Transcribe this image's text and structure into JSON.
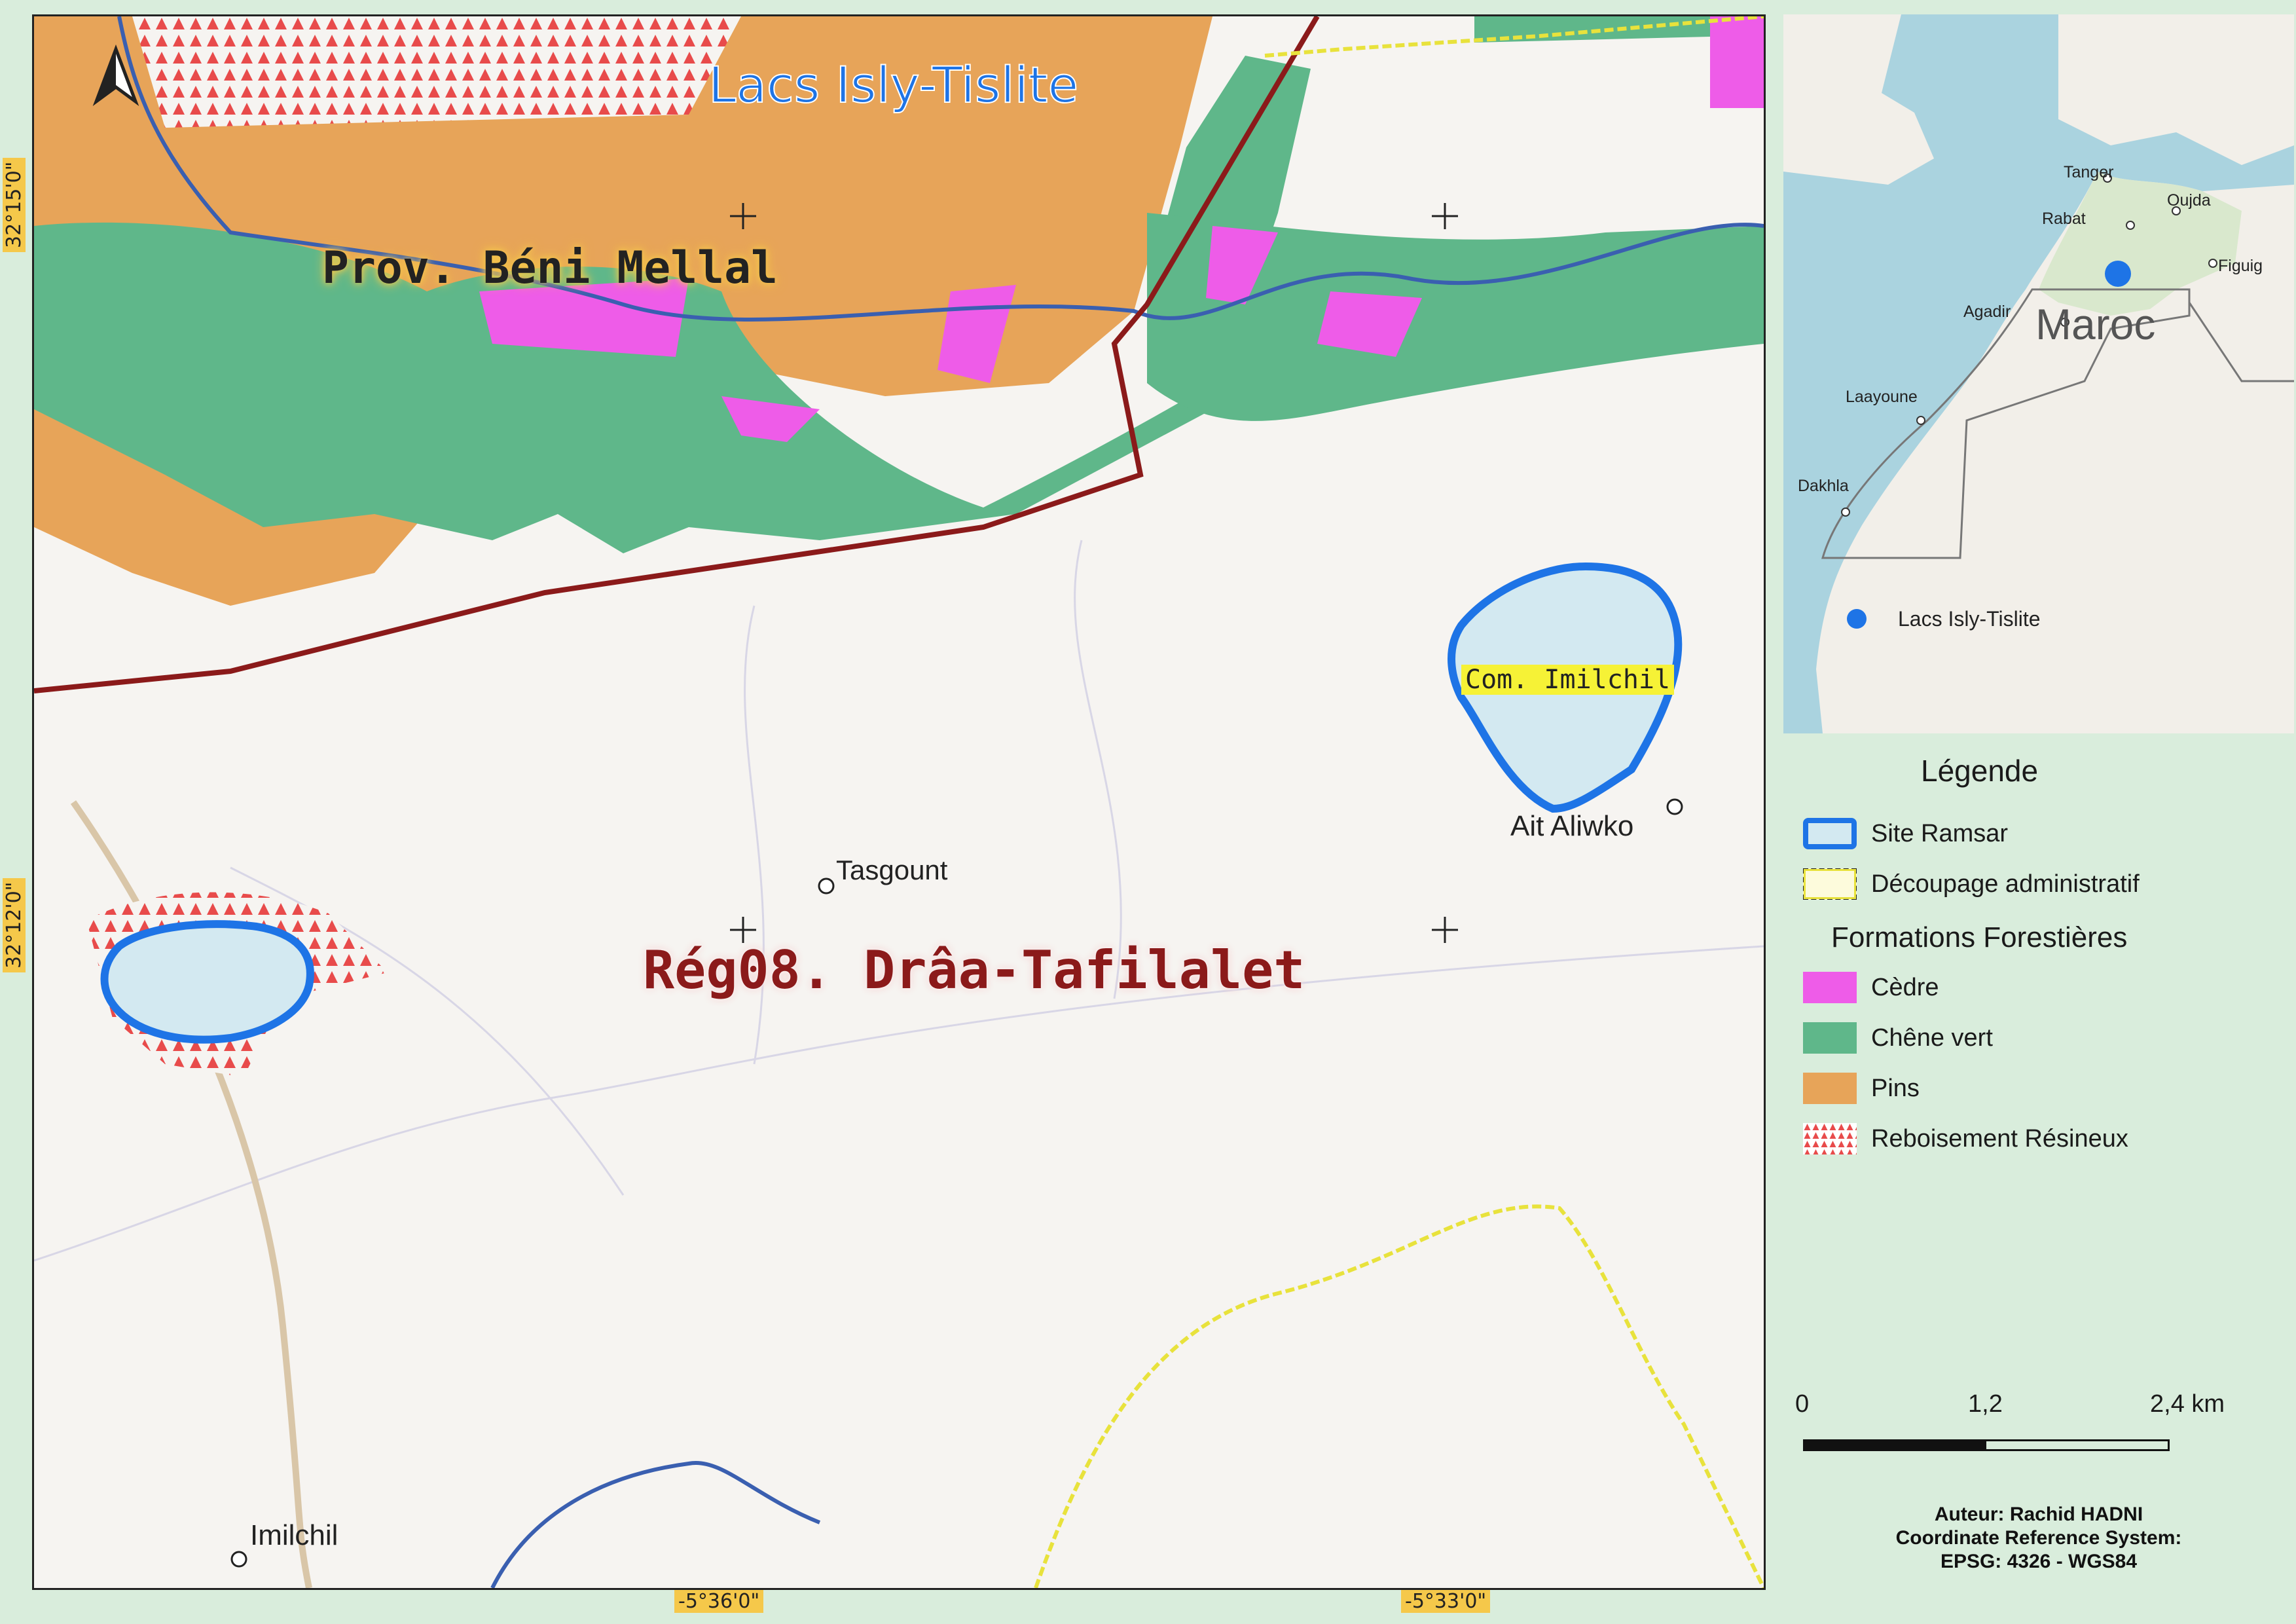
{
  "map": {
    "title": "Lacs Isly-Tislite",
    "labels": {
      "province": "Prov. Béni Mellal",
      "region": "Rég08. Drâa-Tafilalet",
      "commune": "Com. Imilchil"
    },
    "places": [
      {
        "name": "Tasgount"
      },
      {
        "name": "Ait Aliwko"
      },
      {
        "name": "Imilchil"
      }
    ],
    "coordinates": {
      "lat_top": "32°15'0\"",
      "lat_mid": "32°12'0\"",
      "lon_left": "-5°36'0\"",
      "lon_right": "-5°33'0\""
    },
    "north_arrow": "north-arrow-icon",
    "colors": {
      "cedre": "#ee5ce8",
      "chene_vert": "#5fb78a",
      "pins": "#e7a459",
      "reboisement": "#e84b4b",
      "ramsar": "#1e74e6",
      "region_boundary": "#8b1a1a",
      "admin_boundary": "#e8e23c"
    }
  },
  "inset": {
    "country": "Maroc",
    "cities": [
      "Tanger",
      "Oujda",
      "Rabat",
      "Figuig",
      "Agadir",
      "Laayoune",
      "Dakhla"
    ],
    "legend_item": "Lacs Isly-Tislite"
  },
  "legend": {
    "title": "Légende",
    "ramsar": "Site Ramsar",
    "admin": "Découpage administratif",
    "forest_heading": "Formations Forestières",
    "cedre": "Cèdre",
    "chene": "Chêne vert",
    "pins": "Pins",
    "reboisement": "Reboisement Résineux"
  },
  "scale": {
    "ticks": [
      "0",
      "1,2",
      "2,4 km"
    ]
  },
  "credits": {
    "author": "Auteur: Rachid HADNI",
    "crs_label": "Coordinate Reference System:",
    "crs_value": "EPSG: 4326 - WGS84"
  }
}
